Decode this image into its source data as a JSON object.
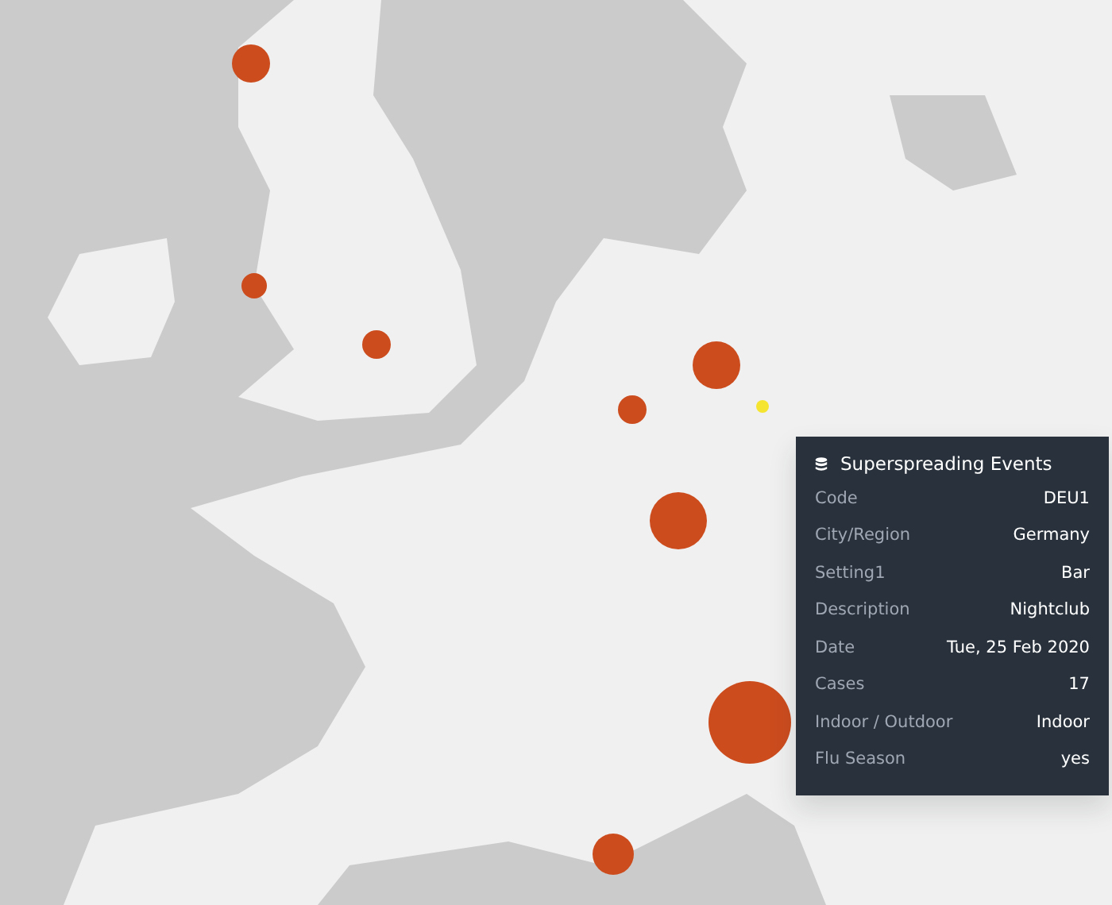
{
  "tooltip": {
    "title": "Superspreading Events",
    "rows": [
      {
        "label": "Code",
        "value": "DEU1"
      },
      {
        "label": "City/Region",
        "value": "Germany"
      },
      {
        "label": "Setting1",
        "value": "Bar"
      },
      {
        "label": "Description",
        "value": "Nightclub"
      },
      {
        "label": "Date",
        "value": "Tue, 25 Feb 2020"
      },
      {
        "label": "Cases",
        "value": "17"
      },
      {
        "label": "Indoor / Outdoor",
        "value": "Indoor"
      },
      {
        "label": "Flu Season",
        "value": "yes"
      }
    ]
  }
}
